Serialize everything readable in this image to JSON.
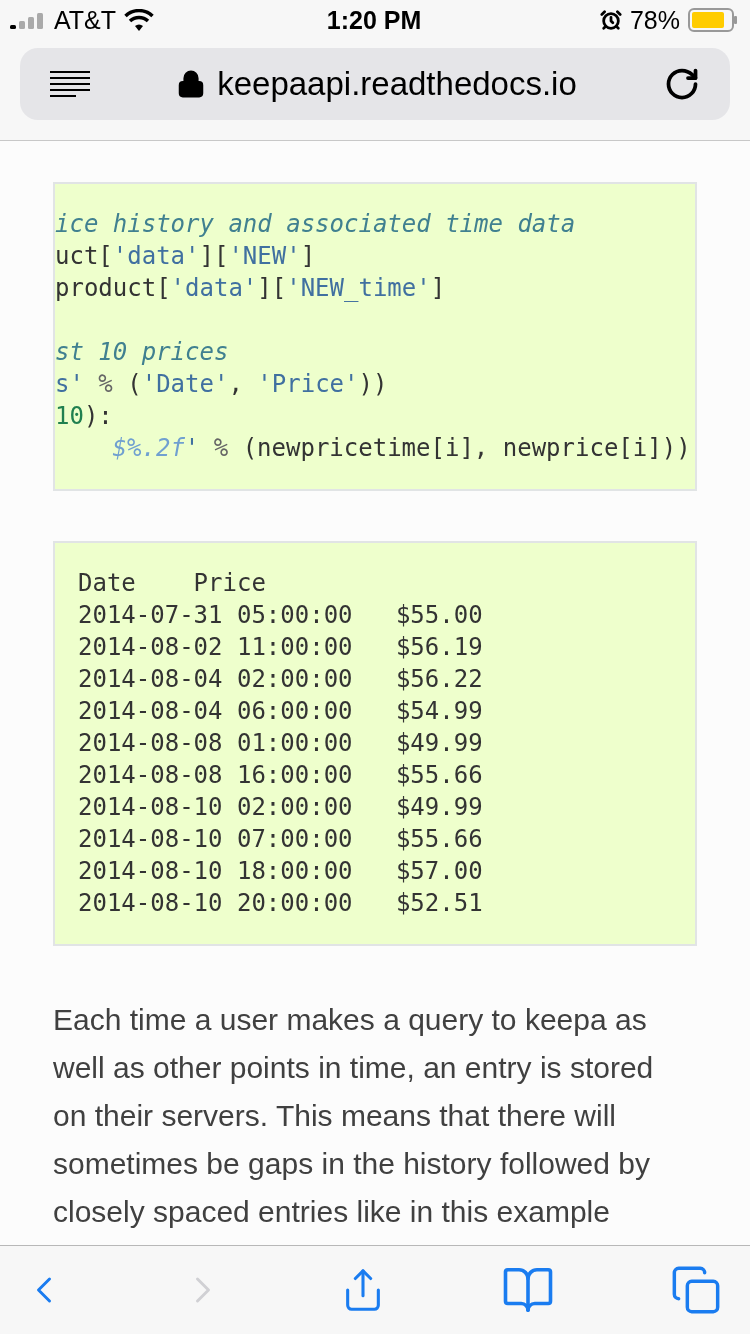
{
  "status_bar": {
    "carrier": "AT&T",
    "time": "1:20 PM",
    "battery": "78%"
  },
  "address_bar": {
    "url": "keepaapi.readthedocs.io"
  },
  "code_block": {
    "lines": [
      [
        {
          "kind": "comment",
          "text": "ice history and associated time data"
        }
      ],
      [
        {
          "kind": "name",
          "text": "uct"
        },
        {
          "kind": "punct",
          "text": "["
        },
        {
          "kind": "string",
          "text": "'data'"
        },
        {
          "kind": "punct",
          "text": "]["
        },
        {
          "kind": "string",
          "text": "'NEW'"
        },
        {
          "kind": "punct",
          "text": "]"
        }
      ],
      [
        {
          "kind": "name",
          "text": "product"
        },
        {
          "kind": "punct",
          "text": "["
        },
        {
          "kind": "string",
          "text": "'data'"
        },
        {
          "kind": "punct",
          "text": "]["
        },
        {
          "kind": "string",
          "text": "'NEW_time'"
        },
        {
          "kind": "punct",
          "text": "]"
        }
      ],
      {
        "kind": "blank"
      },
      [
        {
          "kind": "comment",
          "text": "st 10 prices"
        }
      ],
      [
        {
          "kind": "string",
          "text": "s'"
        },
        {
          "kind": "op",
          "text": " % "
        },
        {
          "kind": "punct",
          "text": "("
        },
        {
          "kind": "string",
          "text": "'Date'"
        },
        {
          "kind": "punct",
          "text": ", "
        },
        {
          "kind": "string",
          "text": "'Price'"
        },
        {
          "kind": "punct",
          "text": "))"
        }
      ],
      [
        {
          "kind": "number",
          "text": "10"
        },
        {
          "kind": "punct",
          "text": "):"
        }
      ],
      {
        "kind": "indented",
        "tokens": [
          {
            "kind": "interp",
            "text": "$%.2f"
          },
          {
            "kind": "string",
            "text": "'"
          },
          {
            "kind": "op",
            "text": " % "
          },
          {
            "kind": "punct",
            "text": "(newpricetime[i], newprice[i]))"
          }
        ]
      }
    ]
  },
  "output_block": {
    "lines": [
      "Date    Price",
      "2014-07-31 05:00:00   $55.00",
      "2014-08-02 11:00:00   $56.19",
      "2014-08-04 02:00:00   $56.22",
      "2014-08-04 06:00:00   $54.99",
      "2014-08-08 01:00:00   $49.99",
      "2014-08-08 16:00:00   $55.66",
      "2014-08-10 02:00:00   $49.99",
      "2014-08-10 07:00:00   $55.66",
      "2014-08-10 18:00:00   $57.00",
      "2014-08-10 20:00:00   $52.51"
    ]
  },
  "paragraph": "Each time a user makes a query to keepa as well as other points in time, an entry is stored on their servers. This means that there will sometimes be gaps in the history followed by closely spaced entries like in this example",
  "toolbar": {
    "buttons": [
      {
        "kind": "back",
        "disabled": false
      },
      {
        "kind": "forward",
        "disabled": true
      },
      {
        "kind": "share",
        "disabled": false
      },
      {
        "kind": "bookmarks",
        "disabled": false
      },
      {
        "kind": "tabs",
        "disabled": false
      }
    ]
  }
}
